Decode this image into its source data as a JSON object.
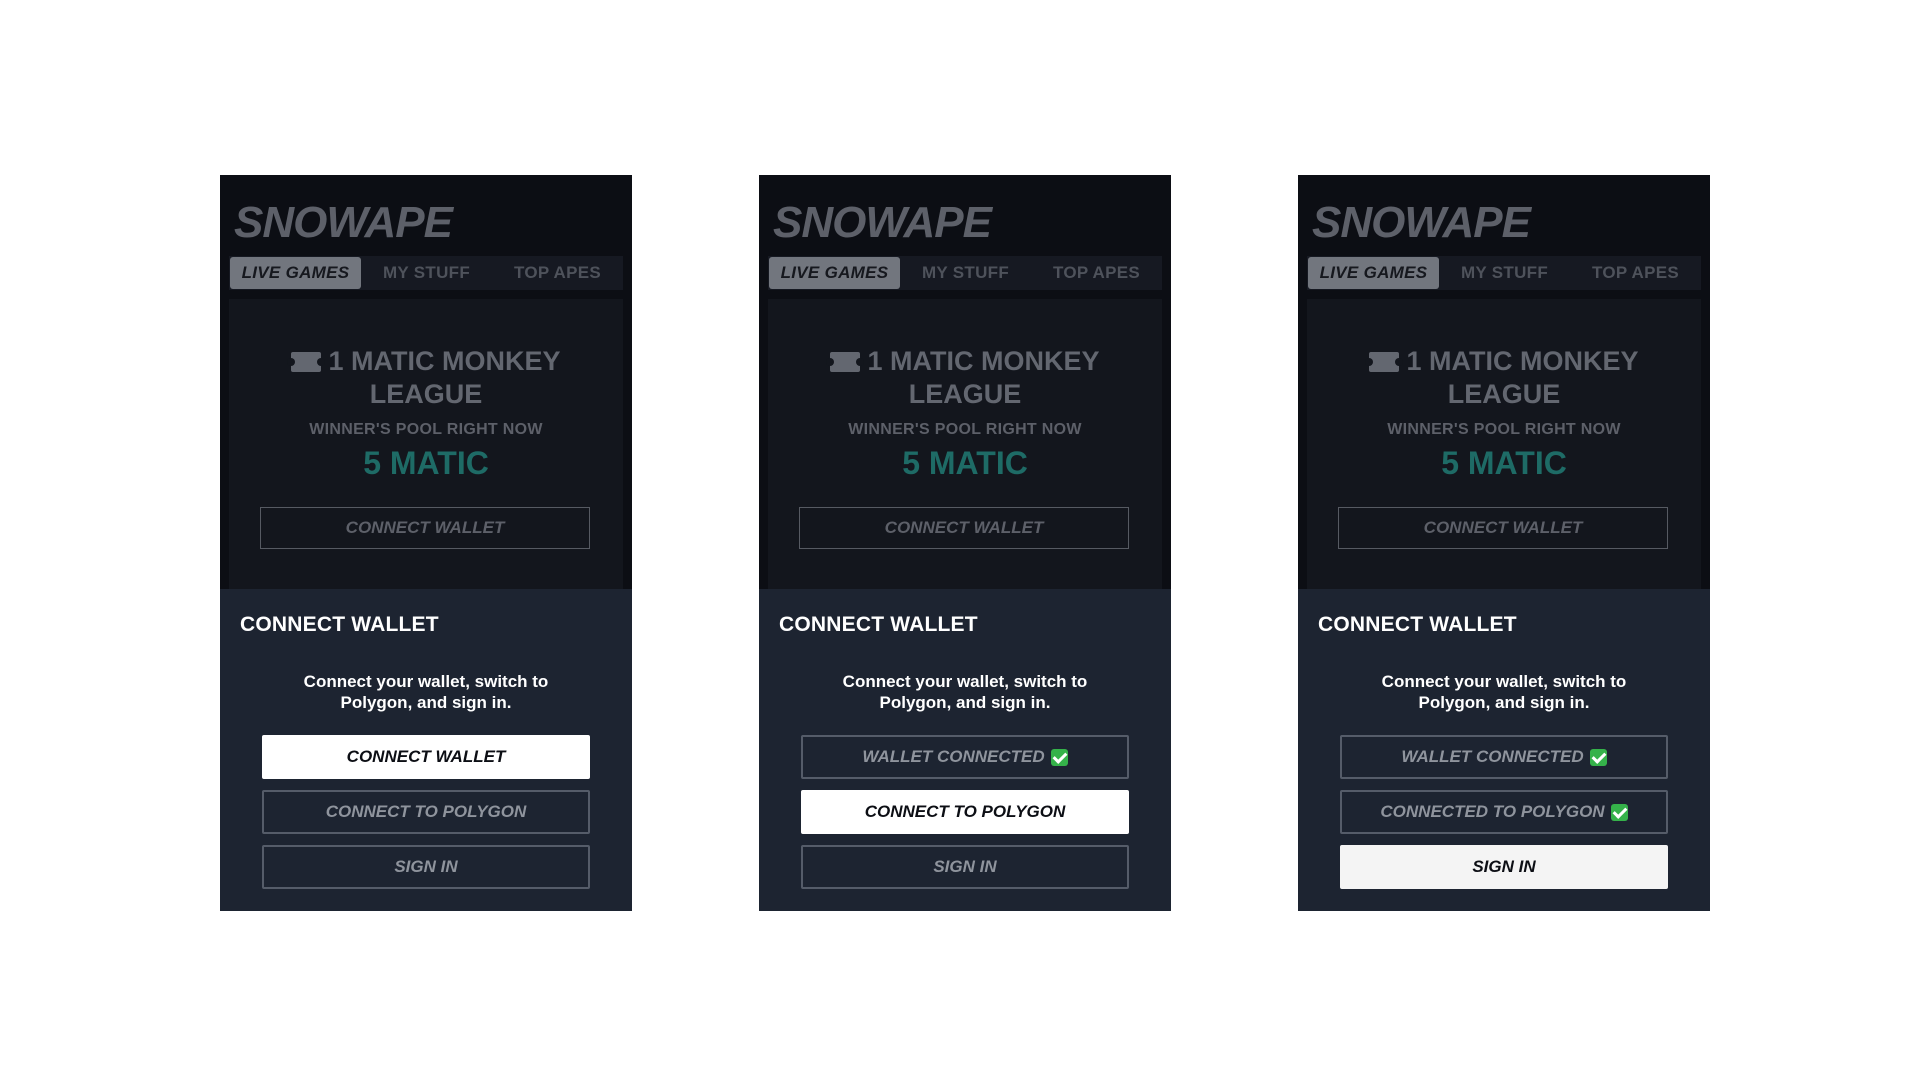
{
  "app": {
    "logo": "SNOWAPE"
  },
  "tabs": [
    "LIVE GAMES",
    "MY STUFF",
    "TOP APES"
  ],
  "card": {
    "league_line1": "1 MATIC MONKEY",
    "league_line2": "LEAGUE",
    "pool_label": "WINNER'S POOL RIGHT NOW",
    "pool_value": "5 MATIC",
    "connect_label": "CONNECT WALLET"
  },
  "modal": {
    "title": "CONNECT WALLET",
    "desc_line1": "Connect your wallet, switch to",
    "desc_line2": "Polygon, and sign in."
  },
  "screens": [
    {
      "step1": "CONNECT WALLET",
      "step2": "CONNECT TO POLYGON",
      "step3": "SIGN IN"
    },
    {
      "step1": "WALLET CONNECTED",
      "step2": "CONNECT TO POLYGON",
      "step3": "SIGN IN"
    },
    {
      "step1": "WALLET CONNECTED",
      "step2": "CONNECTED TO POLYGON",
      "step3": "SIGN IN"
    }
  ],
  "colors": {
    "accent_teal": "#1e6b66",
    "modal_bg": "#1d2431",
    "check_green": "#35b24a"
  }
}
